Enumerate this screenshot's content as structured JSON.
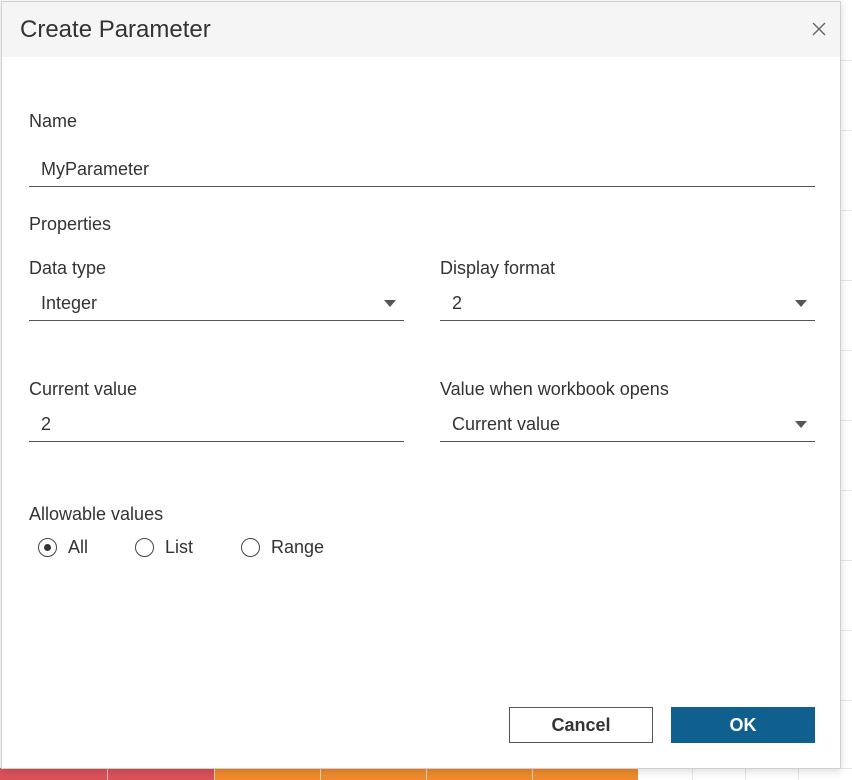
{
  "dialog": {
    "title": "Create Parameter",
    "close_icon": "close-icon"
  },
  "name": {
    "label": "Name",
    "value": "MyParameter"
  },
  "properties": {
    "heading": "Properties",
    "data_type": {
      "label": "Data type",
      "value": "Integer"
    },
    "display_format": {
      "label": "Display format",
      "value": "2"
    },
    "current_value": {
      "label": "Current value",
      "value": "2"
    },
    "value_when_opens": {
      "label": "Value when workbook opens",
      "value": "Current value"
    }
  },
  "allowable_values": {
    "label": "Allowable values",
    "options": [
      {
        "label": "All",
        "selected": true
      },
      {
        "label": "List",
        "selected": false
      },
      {
        "label": "Range",
        "selected": false
      }
    ]
  },
  "buttons": {
    "cancel": "Cancel",
    "ok": "OK"
  },
  "colors": {
    "primary": "#0f5f8f",
    "text": "#333333",
    "titlebar_bg": "#f5f5f5",
    "background_bar_red": "#d9525a",
    "background_bar_orange": "#f08a2c"
  }
}
